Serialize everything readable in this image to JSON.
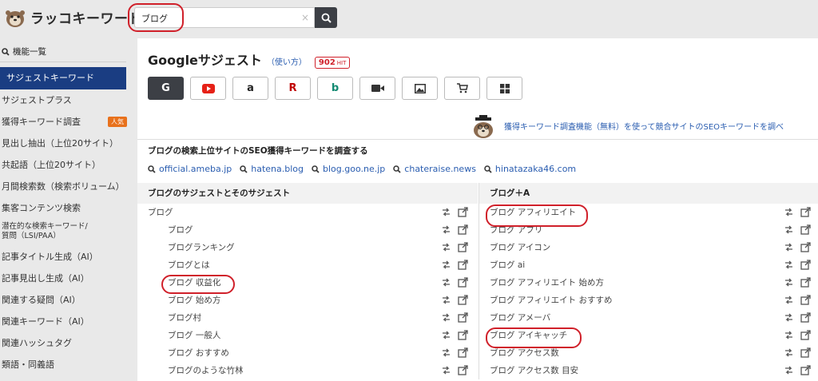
{
  "header": {
    "logo_text": "ラッコキーワード",
    "search_value": "ブログ",
    "clear_label": "×"
  },
  "sidebar": {
    "section_title": "機能一覧",
    "items": [
      {
        "label": "サジェストキーワード",
        "active": true
      },
      {
        "label": "サジェストプラス"
      },
      {
        "label": "獲得キーワード調査",
        "badge": "人気"
      },
      {
        "label": "見出し抽出（上位20サイト）"
      },
      {
        "label": "共起語（上位20サイト）"
      },
      {
        "label": "月間検索数（検索ボリューム）"
      },
      {
        "label": "集客コンテンツ検索"
      },
      {
        "label": "潜在的な検索キーワード/",
        "label2": "質問（LSI/PAA）"
      },
      {
        "label": "記事タイトル生成（AI）"
      },
      {
        "label": "記事見出し生成（AI）"
      },
      {
        "label": "関連する疑問（AI）"
      },
      {
        "label": "関連キーワード（AI）"
      },
      {
        "label": "関連ハッシュタグ"
      },
      {
        "label": "類語・同義語"
      }
    ]
  },
  "main": {
    "title": "Googleサジェスト",
    "usage_link": "（使い方）",
    "hit_count": "902",
    "hit_unit": "HIT",
    "engines": [
      {
        "name": "google-icon",
        "label": "G",
        "selected": true,
        "color": "#ffffff"
      },
      {
        "name": "youtube-icon",
        "color": "#e62117"
      },
      {
        "name": "amazon-icon",
        "label": "a",
        "color": "#222222"
      },
      {
        "name": "rakuten-icon",
        "label": "R",
        "color": "#bf0000"
      },
      {
        "name": "bing-icon",
        "label": "b",
        "color": "#138a72"
      },
      {
        "name": "video-icon",
        "color": "#333333"
      },
      {
        "name": "image-icon",
        "color": "#333333"
      },
      {
        "name": "cart-icon",
        "color": "#333333"
      },
      {
        "name": "app-store-icon",
        "color": "#333333"
      }
    ],
    "promo_text": "獲得キーワード調査機能（無料）を使って競合サイトのSEOキーワードを調べ",
    "seo_title": "ブログの検索上位サイトのSEO獲得キーワードを調査する",
    "sites": [
      "official.ameba.jp",
      "hatena.blog",
      "blog.goo.ne.jp",
      "chateraise.news",
      "hinatazaka46.com"
    ],
    "left_column": {
      "heading": "ブログのサジェストとそのサジェスト",
      "rows": [
        {
          "text": "ブログ",
          "level": "top"
        },
        {
          "text": "ブログ",
          "level": "sub"
        },
        {
          "text": "ブログランキング",
          "level": "sub"
        },
        {
          "text": "ブログとは",
          "level": "sub"
        },
        {
          "text": "ブログ 収益化",
          "level": "sub"
        },
        {
          "text": "ブログ 始め方",
          "level": "sub"
        },
        {
          "text": "ブログ村",
          "level": "sub"
        },
        {
          "text": "ブログ 一般人",
          "level": "sub"
        },
        {
          "text": "ブログ おすすめ",
          "level": "sub"
        },
        {
          "text": "ブログのような竹林",
          "level": "sub"
        }
      ]
    },
    "right_column": {
      "heading": "ブログ＋A",
      "rows": [
        "ブログ アフィリエイト",
        "ブログ アプリ",
        "ブログ アイコン",
        "ブログ ai",
        "ブログ アフィリエイト 始め方",
        "ブログ アフィリエイト おすすめ",
        "ブログ アメーバ",
        "ブログ アイキャッチ",
        "ブログ アクセス数",
        "ブログ アクセス数 目安"
      ]
    }
  },
  "colors": {
    "accent": "#1a3d82",
    "link": "#2a5db0",
    "annotation": "#d0202a",
    "badge": "#e8711c"
  }
}
